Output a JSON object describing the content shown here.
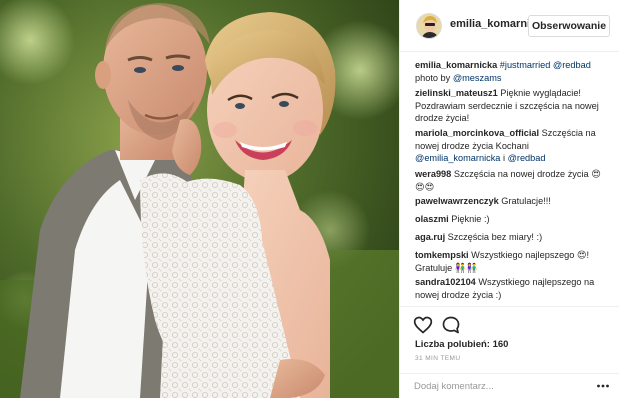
{
  "post": {
    "author": "emilia_komarnici",
    "follow_label": "Obserwowanie"
  },
  "comments": [
    {
      "user": "emilia_komarnicka",
      "parts": [
        {
          "t": " "
        },
        {
          "t": "#justmarried @redbad",
          "link": true
        },
        {
          "t": " photo by "
        },
        {
          "t": "@meszams",
          "link": true
        }
      ]
    },
    {
      "user": "zielinski_mateusz1",
      "parts": [
        {
          "t": " Pięknie wyglądacie! Pozdrawiam serdecznie i szczęścia na nowej drodze życia!"
        }
      ]
    },
    {
      "user": "mariola_morcinkova_official",
      "parts": [
        {
          "t": " Szczęścia na nowej drodze życia Kochani "
        },
        {
          "t": "@emilia_komarnicka",
          "link": true
        },
        {
          "t": " i "
        },
        {
          "t": "@redbad",
          "link": true
        }
      ]
    },
    {
      "user": "wera998",
      "parts": [
        {
          "t": " Szczęścia na nowej drodze życia 😍😍😍"
        }
      ]
    },
    {
      "user": "pawelwawrzenczyk",
      "parts": [
        {
          "t": " Gratulacje!!!"
        }
      ]
    },
    {
      "user": "olaszmi",
      "parts": [
        {
          "t": " Pięknie :)"
        }
      ]
    },
    {
      "user": "aga.ruj",
      "parts": [
        {
          "t": " Szczęścia bez miary! :)"
        }
      ]
    },
    {
      "user": "tomkempski",
      "parts": [
        {
          "t": " Wszystkiego najlepszego 😍! Gratuluje 👫👫"
        }
      ]
    },
    {
      "user": "sandra102104",
      "parts": [
        {
          "t": " Wszystkiego najlepszego na nowej drodze życia :)"
        }
      ]
    }
  ],
  "footer": {
    "likes_label": "Liczba polubień: 160",
    "time_ago": "31 MIN TEMU",
    "comment_placeholder": "Dodaj komentarz..."
  },
  "icons": {
    "like": "heart-icon",
    "comment": "comment-bubble-icon",
    "more": "more-options-icon"
  },
  "colors": {
    "link": "#003569",
    "text": "#262626",
    "muted": "#999999",
    "border": "#efefef"
  }
}
